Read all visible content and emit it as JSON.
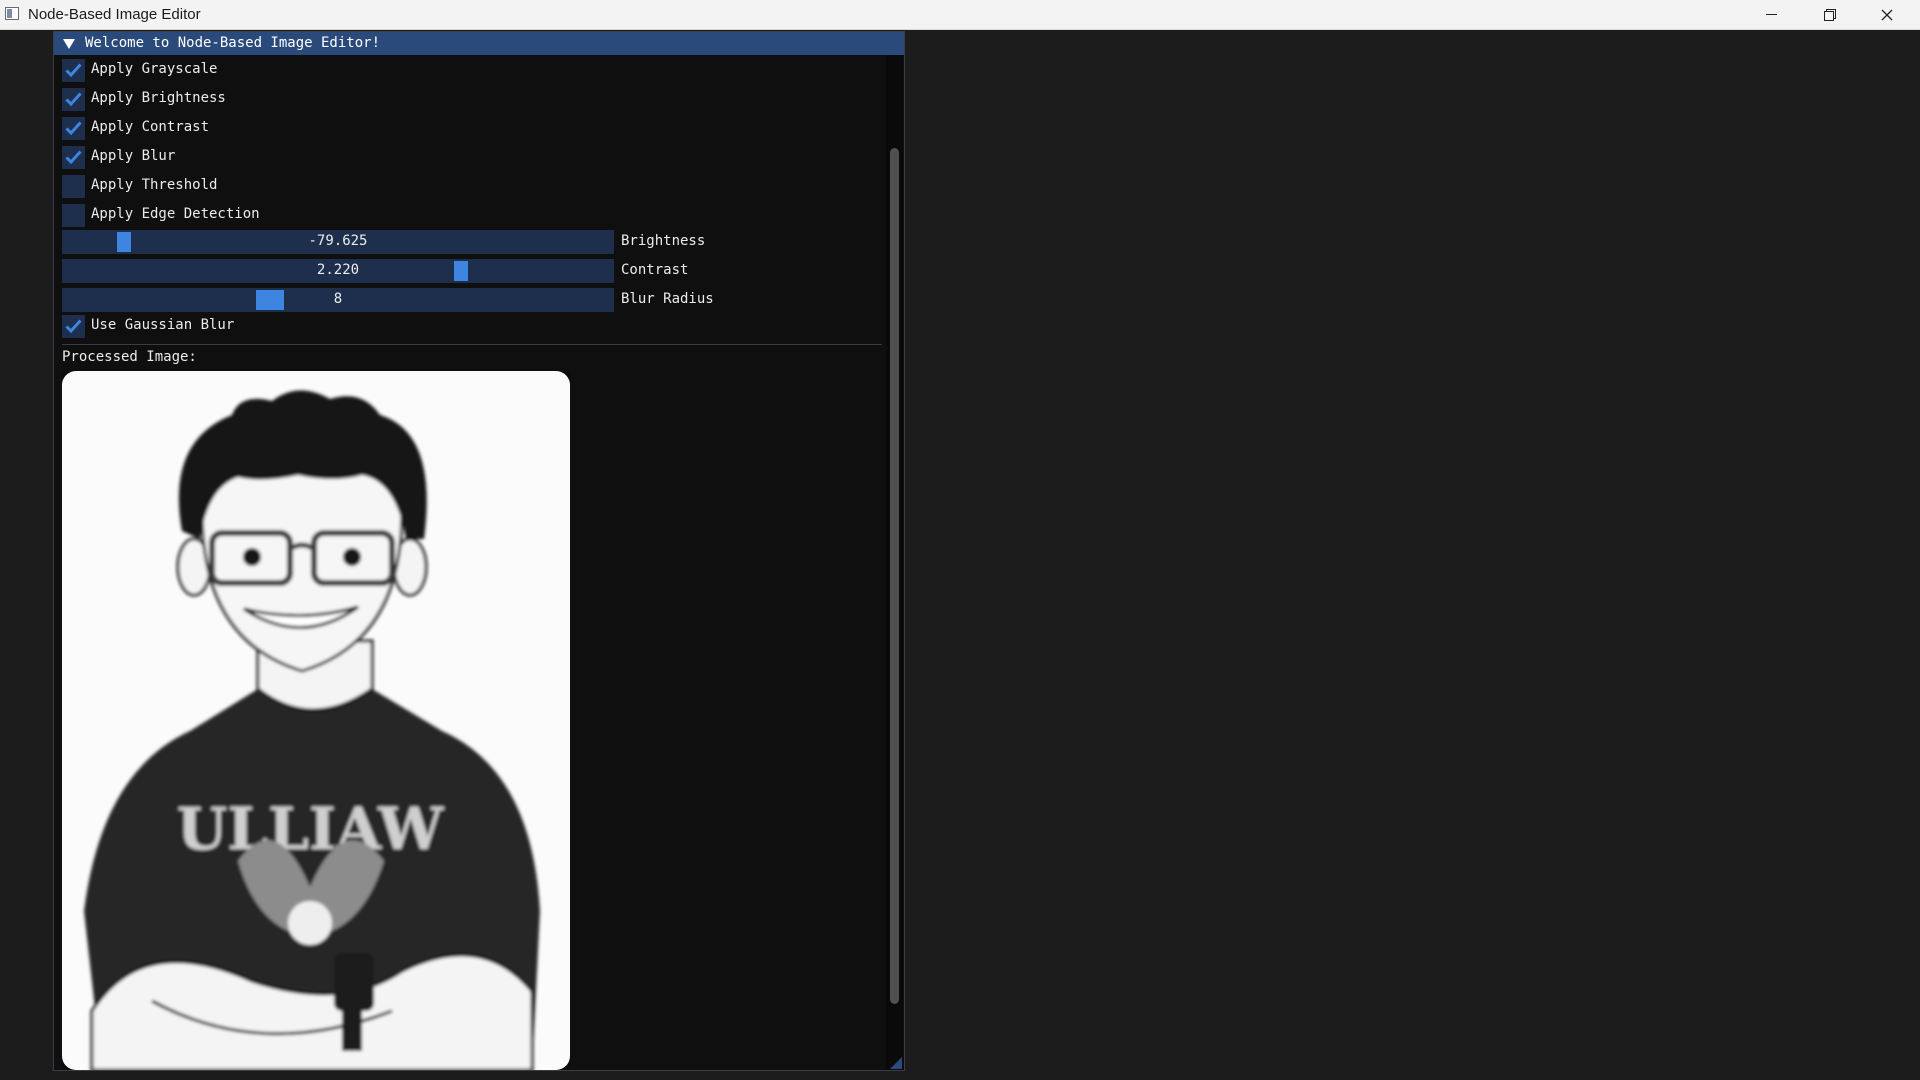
{
  "app": {
    "window_title": "Node-Based Image Editor",
    "icon": "app-icon"
  },
  "window_controls": {
    "minimize_icon": "minimize-icon",
    "maximize_icon": "restore-icon",
    "close_icon": "close-icon"
  },
  "panel": {
    "header_title": "Welcome to Node-Based Image Editor!",
    "collapse_icon": "triangle-down-icon",
    "options": [
      {
        "label": "Apply Grayscale",
        "checked": true
      },
      {
        "label": "Apply Brightness",
        "checked": true
      },
      {
        "label": "Apply Contrast",
        "checked": true
      },
      {
        "label": "Apply Blur",
        "checked": true
      },
      {
        "label": "Apply Threshold",
        "checked": false
      },
      {
        "label": "Apply Edge Detection",
        "checked": false
      }
    ],
    "sliders": [
      {
        "label": "Brightness",
        "value": "-79.625",
        "fraction": 0.1
      },
      {
        "label": "Contrast",
        "value": "2.220",
        "fraction": 0.73
      },
      {
        "label": "Blur Radius",
        "value": "8",
        "fraction": 0.37
      }
    ],
    "gaussian": {
      "label": "Use Gaussian Blur",
      "checked": true
    },
    "processed_label": "Processed Image:",
    "image_text": "ULLIAW"
  },
  "colors": {
    "accent": "#3d85e0",
    "frame_bg": "#1d2f4d",
    "header_bg": "#294a7a",
    "window_bg": "#0f0f0f"
  }
}
